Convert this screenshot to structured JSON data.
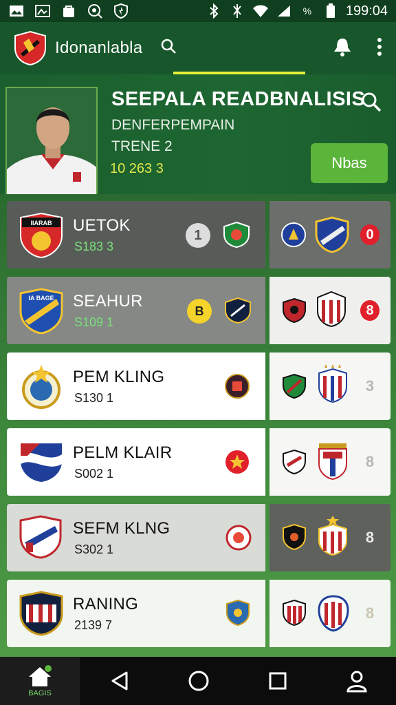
{
  "status_bar": {
    "time": "199:04",
    "battery_label": "%"
  },
  "app_bar": {
    "title": "Idonanlabla"
  },
  "hero": {
    "title": "SEEPALA READBNALISIS",
    "subtitle": "DENFERPEMPAIN",
    "line2": "TRENE 2",
    "stat": "10 263   3",
    "news_button": "Nbas"
  },
  "teams": [
    {
      "name": "UETOK",
      "stat": "S183   3",
      "crest_label": "IIARAB",
      "score": "0",
      "badge": "1",
      "score_color": "#e0202a"
    },
    {
      "name": "SEAHUR",
      "stat": "S109   1",
      "crest_label": "IA BAGE",
      "score": "8",
      "badge": "B",
      "score_color": "#e0202a"
    },
    {
      "name": "PEM KLING",
      "stat": "S130   1",
      "crest_label": "",
      "score": "3",
      "badge": "",
      "score_color": "#b8b8b8"
    },
    {
      "name": "PELM KLAIR",
      "stat": "S002   1",
      "crest_label": "",
      "score": "8",
      "badge": "",
      "score_color": "#b8b8b8"
    },
    {
      "name": "SEFM KLNG",
      "stat": "S302   1",
      "crest_label": "",
      "score": "8",
      "badge": "",
      "score_color": "#e8e8e8"
    },
    {
      "name": "RANING",
      "stat": "2139   7",
      "crest_label": "",
      "score": "8",
      "badge": "",
      "score_color": "#c9c6b0"
    }
  ],
  "bottom_nav": {
    "home_label": "BAGIS"
  },
  "colors": {
    "primary_green": "#17572b",
    "accent_yellow": "#e6f03a",
    "button_green": "#5bb53a"
  }
}
